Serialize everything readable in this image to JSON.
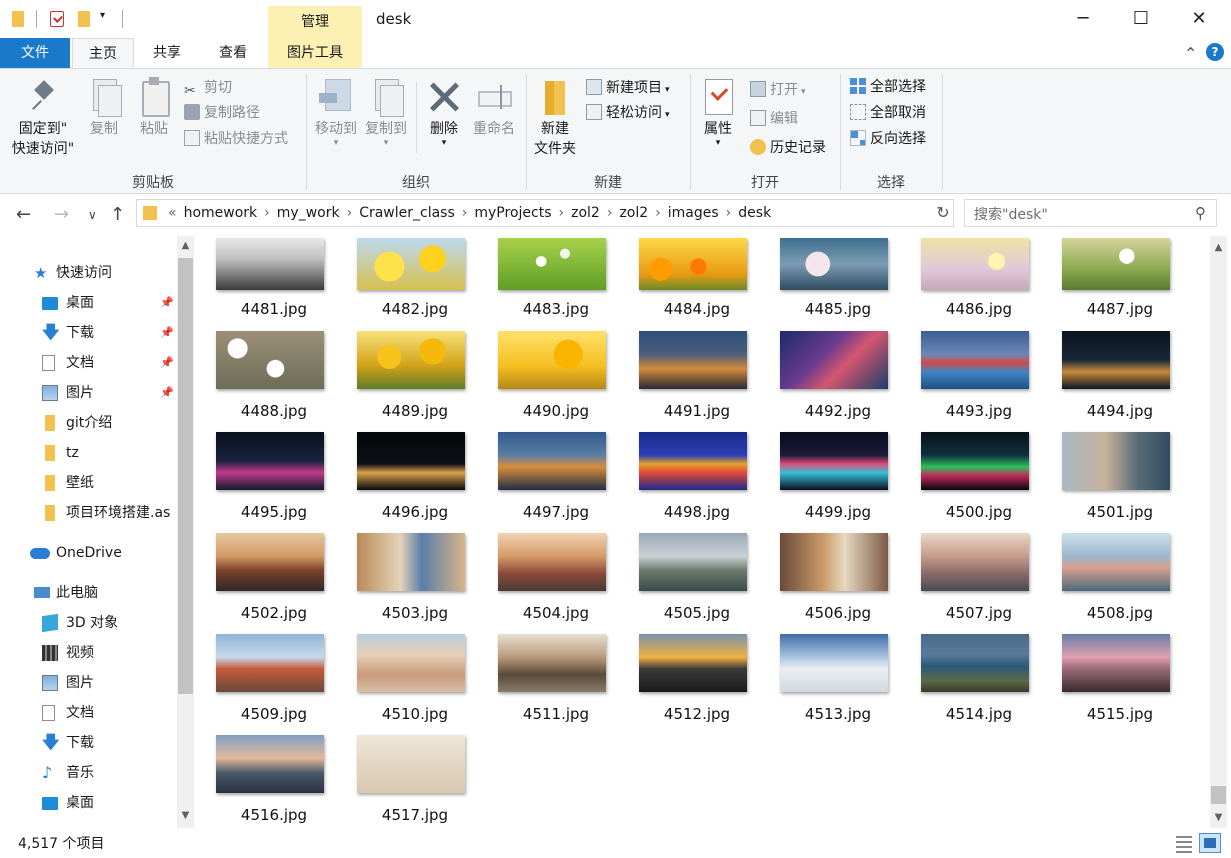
{
  "window": {
    "title": "desk",
    "context_tab_label": "管理",
    "controls": {
      "minimize": "─",
      "maximize": "☐",
      "close": "✕"
    }
  },
  "ribbon_tabs": [
    "文件",
    "主页",
    "共享",
    "查看",
    "图片工具"
  ],
  "ribbon": {
    "clipboard": {
      "label": "剪贴板",
      "pin": "固定到\"\n快速访问\"",
      "copy": "复制",
      "paste": "粘贴",
      "cut": "剪切",
      "copy_path": "复制路径",
      "paste_shortcut": "粘贴快捷方式"
    },
    "organize": {
      "label": "组织",
      "move_to": "移动到",
      "copy_to": "复制到",
      "delete": "删除",
      "rename": "重命名"
    },
    "new": {
      "label": "新建",
      "new_folder": "新建\n文件夹",
      "new_item": "新建项目",
      "easy_access": "轻松访问"
    },
    "open": {
      "label": "打开",
      "properties": "属性",
      "open": "打开",
      "edit": "编辑",
      "history": "历史记录"
    },
    "select": {
      "label": "选择",
      "select_all": "全部选择",
      "select_none": "全部取消",
      "invert": "反向选择"
    }
  },
  "address": {
    "prefix": "«",
    "path": [
      "homework",
      "my_work",
      "Crawler_class",
      "myProjects",
      "zol2",
      "zol2",
      "images",
      "desk"
    ],
    "search_placeholder": "搜索\"desk\""
  },
  "nav_pane": {
    "quick_access": "快速访问",
    "pinned": [
      "桌面",
      "下载",
      "文档",
      "图片"
    ],
    "recent": [
      "git介绍",
      "tz",
      "壁纸",
      "项目环境搭建.as"
    ],
    "onedrive": "OneDrive",
    "this_pc": "此电脑",
    "pc_items": [
      "3D 对象",
      "视频",
      "图片",
      "文档",
      "下载",
      "音乐",
      "桌面"
    ]
  },
  "files": [
    {
      "name": "4481.jpg",
      "theme": "snow-bw"
    },
    {
      "name": "4482.jpg",
      "theme": "yellow-flowers"
    },
    {
      "name": "4483.jpg",
      "theme": "green-meadow"
    },
    {
      "name": "4484.jpg",
      "theme": "tulips"
    },
    {
      "name": "4485.jpg",
      "theme": "blossom"
    },
    {
      "name": "4486.jpg",
      "theme": "daisy-pastel"
    },
    {
      "name": "4487.jpg",
      "theme": "daisy-olive"
    },
    {
      "name": "4488.jpg",
      "theme": "daisies"
    },
    {
      "name": "4489.jpg",
      "theme": "sunflowers"
    },
    {
      "name": "4490.jpg",
      "theme": "sunflowers-bright"
    },
    {
      "name": "4491.jpg",
      "theme": "city-night-orange"
    },
    {
      "name": "4492.jpg",
      "theme": "city-blue-pink"
    },
    {
      "name": "4493.jpg",
      "theme": "harbor-colorful"
    },
    {
      "name": "4494.jpg",
      "theme": "coast-night"
    },
    {
      "name": "4495.jpg",
      "theme": "tower-night"
    },
    {
      "name": "4496.jpg",
      "theme": "castle-night"
    },
    {
      "name": "4497.jpg",
      "theme": "venice-dusk"
    },
    {
      "name": "4498.jpg",
      "theme": "skyline-reflect"
    },
    {
      "name": "4499.jpg",
      "theme": "hongkong-night"
    },
    {
      "name": "4500.jpg",
      "theme": "neon-green"
    },
    {
      "name": "4501.jpg",
      "theme": "canal-woman"
    },
    {
      "name": "4502.jpg",
      "theme": "tram-sunset"
    },
    {
      "name": "4503.jpg",
      "theme": "street-tram"
    },
    {
      "name": "4504.jpg",
      "theme": "sf-cable-car"
    },
    {
      "name": "4505.jpg",
      "theme": "alpine-village"
    },
    {
      "name": "4506.jpg",
      "theme": "old-street"
    },
    {
      "name": "4507.jpg",
      "theme": "coastal-town"
    },
    {
      "name": "4508.jpg",
      "theme": "harbor-day"
    },
    {
      "name": "4509.jpg",
      "theme": "seaside-road"
    },
    {
      "name": "4510.jpg",
      "theme": "monaco-casino"
    },
    {
      "name": "4511.jpg",
      "theme": "alley-people"
    },
    {
      "name": "4512.jpg",
      "theme": "cliff-sunset"
    },
    {
      "name": "4513.jpg",
      "theme": "snow-hiker"
    },
    {
      "name": "4514.jpg",
      "theme": "coast-cliff"
    },
    {
      "name": "4515.jpg",
      "theme": "pink-sea"
    },
    {
      "name": "4516.jpg",
      "theme": "mountain-dusk"
    },
    {
      "name": "4517.jpg",
      "theme": "sand-desert"
    }
  ],
  "status": {
    "count": "4,517 个项目"
  }
}
